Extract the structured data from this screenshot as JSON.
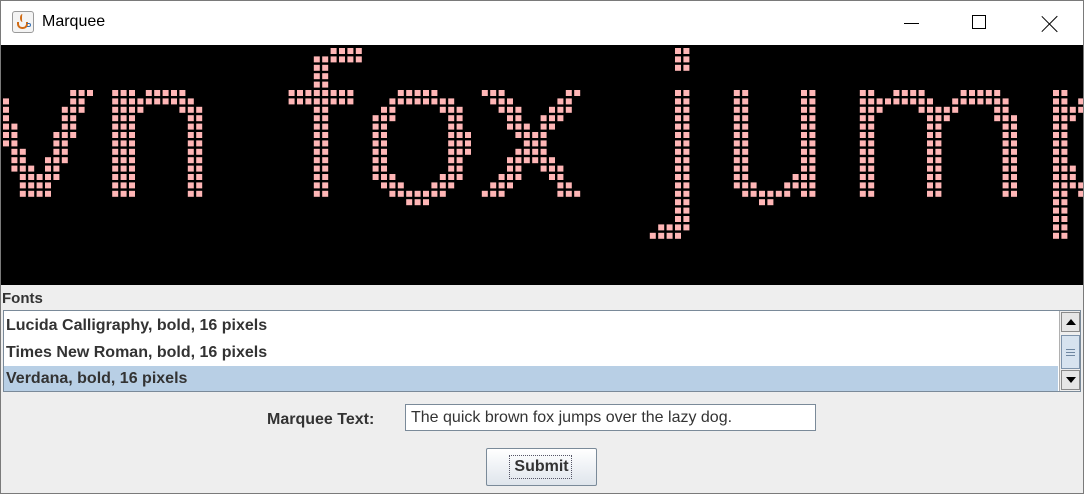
{
  "window": {
    "title": "Marquee",
    "app_icon": "java-cup-icon",
    "controls": [
      "minimize-icon",
      "maximize-icon",
      "close-icon"
    ]
  },
  "marquee": {
    "visible_text": "vn fox jumps",
    "background_color": "#000000",
    "dot_color": "#ffb6b6"
  },
  "fonts": {
    "label": "Fonts",
    "items": [
      "Lucida Calligraphy, bold, 16 pixels",
      "Times New Roman, bold, 16 pixels",
      "Verdana, bold, 16 pixels"
    ],
    "selected_index": 2,
    "selection_color": "#b8cfe5"
  },
  "form": {
    "marquee_label": "Marquee Text:",
    "marquee_value": "The quick brown fox jumps over the lazy dog.",
    "submit_label": "Submit"
  }
}
